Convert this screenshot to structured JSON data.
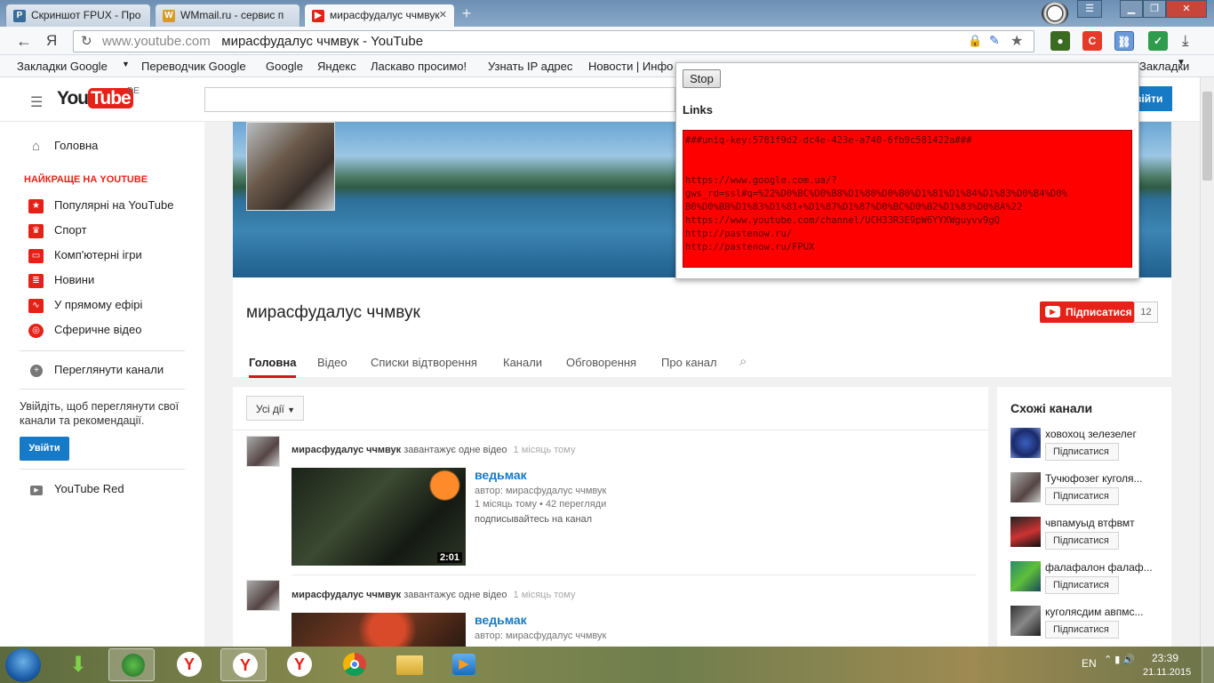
{
  "tabs": [
    {
      "label": "Скриншот FPUX - Про",
      "icon": "P",
      "color": "#3a6b9a"
    },
    {
      "label": "WMmail.ru - сервис п",
      "icon": "W",
      "color": "#d89b2a"
    },
    {
      "label": "мирасфудалус ччмвук",
      "icon": "▶",
      "color": "#e62117"
    }
  ],
  "address": {
    "host": "www.youtube.com",
    "title": "мирасфудалус ччмвук - YouTube"
  },
  "bookmarks": [
    "Закладки Google",
    "Переводчик Google",
    "Google",
    "Яндекс",
    "Ласкаво просимо!",
    "Узнать IP адрес",
    "Новости | Инфо",
    "Закладки"
  ],
  "yt": {
    "logo": "YouTube",
    "region": "DE",
    "signin": "Увійти",
    "sidebar": {
      "home": "Головна",
      "best_header": "НАЙКРАЩЕ НА YOUTUBE",
      "best": [
        "Популярні на YouTube",
        "Спорт",
        "Комп'ютерні ігри",
        "Новини",
        "У прямому ефірі",
        "Сферичне відео"
      ],
      "browse": "Переглянути канали",
      "signin_prompt": "Увійдіть, щоб переглянути свої канали та рекомендації.",
      "signin_btn": "Увійти",
      "red": "YouTube Red"
    },
    "channel": {
      "name": "мирасфудалус ччмвук",
      "subscribe": "Підписатися",
      "sub_count": "12",
      "tabs": [
        "Головна",
        "Відео",
        "Списки відтворення",
        "Канали",
        "Обговорення",
        "Про канал"
      ]
    },
    "feed": {
      "filter": "Усі дії",
      "items": [
        {
          "author": "мирасфудалус ччмвук",
          "action": "завантажує одне відео",
          "when": "1 місяць тому",
          "title": "ведьмак",
          "by": "автор: мирасфудалус ччмвук",
          "meta": "1 місяць тому • 42 перегляди",
          "desc": "подписывайтесь на канал",
          "duration": "2:01"
        },
        {
          "author": "мирасфудалус ччмвук",
          "action": "завантажує одне відео",
          "when": "1 місяць тому",
          "title": "ведьмак",
          "by": "автор: мирасфудалус ччмвук",
          "meta": "",
          "desc": "",
          "duration": ""
        }
      ]
    },
    "related": {
      "title": "Схожі канали",
      "subscribe": "Підписатися",
      "channels": [
        "ховохоц зелезелег",
        "Тучюфозег куголя...",
        "чвпамуыд втфвмт",
        "фалафалон фалаф...",
        "куголясдим авпмс..."
      ]
    }
  },
  "popup": {
    "stop": "Stop",
    "links_label": "Links",
    "links_text": "###uniq-key:5781f9d2-dc4e-423e-a740-6fb9c581422a###\n\n\nhttps://www.google.com.ua/?\ngws_rd=ssl#q=%22%D0%BC%D0%B8%D1%80%D0%B0%D1%81%D1%84%D1%83%D0%B4%D0%\nB0%D0%BB%D1%83%D1%81+%D1%87%D1%87%D0%BC%D0%B2%D1%83%D0%BA%22\nhttps://www.youtube.com/channel/UCH33R3E9pW6YYXWguyvv9gQ\nhttp://pastenow.ru/\nhttp://pastenow.ru/FPUX"
  },
  "taskbar": {
    "lang": "EN",
    "time": "23:39",
    "date": "21.11.2015"
  }
}
